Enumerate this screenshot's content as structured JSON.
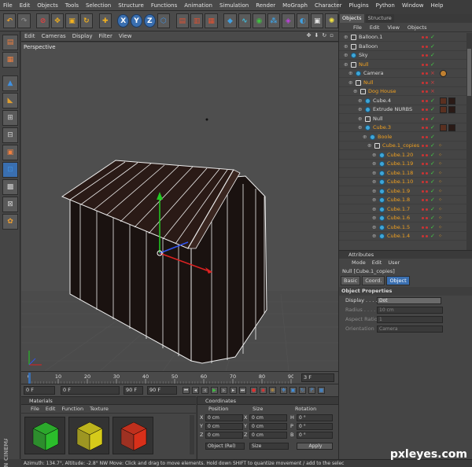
{
  "menu": [
    "File",
    "Edit",
    "Objects",
    "Tools",
    "Selection",
    "Structure",
    "Functions",
    "Animation",
    "Simulation",
    "Render",
    "MoGraph",
    "Character",
    "Plugins",
    "Python",
    "Window",
    "Help"
  ],
  "toolbar": {
    "axis_x": "X",
    "axis_y": "Y",
    "axis_z": "Z"
  },
  "viewport": {
    "menu": [
      "Edit",
      "Cameras",
      "Display",
      "Filter",
      "View"
    ],
    "label": "Perspective"
  },
  "timeline": {
    "ticks": [
      "0",
      "10",
      "20",
      "30",
      "40",
      "50",
      "60",
      "70",
      "80",
      "90"
    ],
    "current_frame": "3 F"
  },
  "playback": {
    "start": "0 F",
    "current": "0 F",
    "end_a": "90 F",
    "end_b": "90 F"
  },
  "materials": {
    "title": "Materials",
    "menu": [
      "File",
      "Edit",
      "Function",
      "Texture"
    ],
    "colors": [
      "#2bbd2b",
      "#d6cb1a",
      "#d8301a"
    ]
  },
  "coordinates": {
    "title": "Coordinates",
    "headers": [
      "Position",
      "Size",
      "Rotation"
    ],
    "rows": [
      {
        "axis": "X",
        "pos": "0 cm",
        "size_axis": "X",
        "size": "0 cm",
        "rot_axis": "H",
        "rot": "0 °"
      },
      {
        "axis": "Y",
        "pos": "0 cm",
        "size_axis": "Y",
        "size": "0 cm",
        "rot_axis": "P",
        "rot": "0 °"
      },
      {
        "axis": "Z",
        "pos": "0 cm",
        "size_axis": "Z",
        "size": "0 cm",
        "rot_axis": "B",
        "rot": "0 °"
      }
    ],
    "mode": "Object (Rel)",
    "size_mode": "Size",
    "apply": "Apply"
  },
  "status": "Azimuth: 134.7°, Altitude: -2.8°  NW  Move: Click and drag to move elements. Hold down SHIFT to quantize movement / add to the selec",
  "objects": {
    "tabs": [
      "Objects",
      "Structure"
    ],
    "menu": [
      "File",
      "Edit",
      "View",
      "Objects"
    ],
    "rows": [
      {
        "name": "Balloon.1",
        "indent": 0,
        "color": "#d8d8d8"
      },
      {
        "name": "Balloon",
        "indent": 0,
        "color": "#d8d8d8"
      },
      {
        "name": "Sky",
        "indent": 0,
        "color": "#d8d8d8"
      },
      {
        "name": "Null",
        "indent": 0,
        "color": "#f0a020"
      },
      {
        "name": "Camera",
        "indent": 1,
        "color": "#d8d8d8"
      },
      {
        "name": "Null",
        "indent": 1,
        "color": "#f0a020"
      },
      {
        "name": "Dog House",
        "indent": 2,
        "color": "#f0a020"
      },
      {
        "name": "Cube.4",
        "indent": 3,
        "color": "#d8d8d8"
      },
      {
        "name": "Extrude NURBS",
        "indent": 3,
        "color": "#d8d8d8"
      },
      {
        "name": "Null",
        "indent": 3,
        "color": "#d8d8d8"
      },
      {
        "name": "Cube.3",
        "indent": 3,
        "color": "#f0a020"
      },
      {
        "name": "Boole",
        "indent": 4,
        "color": "#f0a020"
      },
      {
        "name": "Cube.1_copies",
        "indent": 5,
        "color": "#f0a020"
      },
      {
        "name": "Cube.1.20",
        "indent": 6,
        "color": "#f0a020"
      },
      {
        "name": "Cube.1.19",
        "indent": 6,
        "color": "#f0a020"
      },
      {
        "name": "Cube.1.18",
        "indent": 6,
        "color": "#f0a020"
      },
      {
        "name": "Cube.1.10",
        "indent": 6,
        "color": "#f0a020"
      },
      {
        "name": "Cube.1.9",
        "indent": 6,
        "color": "#f0a020"
      },
      {
        "name": "Cube.1.8",
        "indent": 6,
        "color": "#f0a020"
      },
      {
        "name": "Cube.1.7",
        "indent": 6,
        "color": "#f0a020"
      },
      {
        "name": "Cube.1.6",
        "indent": 6,
        "color": "#f0a020"
      },
      {
        "name": "Cube.1.5",
        "indent": 6,
        "color": "#f0a020"
      },
      {
        "name": "Cube.1.4",
        "indent": 6,
        "color": "#f0a020"
      }
    ]
  },
  "attributes": {
    "title": "Attributes",
    "menu": [
      "Mode",
      "Edit",
      "User"
    ],
    "object_name": "Null [Cube.1_copies]",
    "tabs": [
      "Basic",
      "Coord.",
      "Object"
    ],
    "section": "Object Properties",
    "props": [
      {
        "label": "Display . . . . .",
        "value": "Dot",
        "dim": false
      },
      {
        "label": "Radius . . . . .",
        "value": "10 cm",
        "dim": true
      },
      {
        "label": "Aspect Ratio",
        "value": "1",
        "dim": true
      },
      {
        "label": "Orientation",
        "value": "Camera",
        "dim": true
      }
    ]
  },
  "logo": "MAXON CINEMA 4D",
  "watermark": "pxleyes.com",
  "accent": "#3a6fb0"
}
